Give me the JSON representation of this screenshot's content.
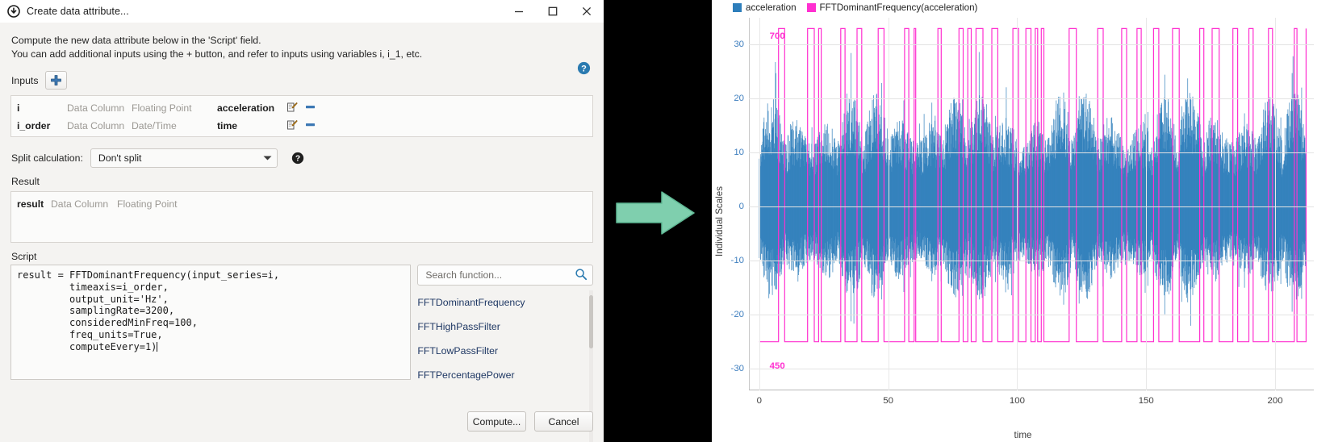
{
  "dialog": {
    "title": "Create data attribute...",
    "title_icon": "circle-arrow-down-icon",
    "window": {
      "minimize": "minimize-icon",
      "maximize": "maximize-icon",
      "close": "close-icon"
    },
    "intro_line1": "Compute the new data attribute below in the 'Script' field.",
    "intro_line2": "You can add additional inputs using the + button, and refer to inputs using variables i, i_1, etc.",
    "help_icon": "help-icon",
    "inputs": {
      "label": "Inputs",
      "add_button": "plus-icon",
      "rows": [
        {
          "var": "i",
          "kind": "Data Column",
          "type": "Floating Point",
          "value": "acceleration",
          "edit_icon": "edit-pencil-icon",
          "remove_icon": "remove-minus-icon"
        },
        {
          "var": "i_order",
          "kind": "Data Column",
          "type": "Date/Time",
          "value": "time",
          "edit_icon": "edit-pencil-icon",
          "remove_icon": "remove-minus-icon"
        }
      ]
    },
    "split": {
      "label": "Split calculation:",
      "value": "Don't split",
      "options": [
        "Don't split"
      ],
      "help_icon": "help-icon"
    },
    "result": {
      "label": "Result",
      "var": "result",
      "kind": "Data Column",
      "type": "Floating Point"
    },
    "script": {
      "label": "Script",
      "lines": [
        "result = FFTDominantFrequency(input_series=i,",
        "         timeaxis=i_order,",
        "         output_unit='Hz',",
        "         samplingRate=3200,",
        "         consideredMinFreq=100,",
        "         freq_units=True,",
        "         computeEvery=1)"
      ]
    },
    "functions": {
      "search_placeholder": "Search function...",
      "search_value": "",
      "search_icon": "magnifier-icon",
      "items": [
        "FFTDominantFrequency",
        "FFTHighPassFilter",
        "FFTLowPassFilter",
        "FFTPercentagePower"
      ]
    },
    "buttons": {
      "compute": "Compute...",
      "cancel": "Cancel"
    }
  },
  "transition": {
    "arrow_icon": "right-arrow-icon",
    "arrow_color": "#7fcfae"
  },
  "chart_data": {
    "type": "line",
    "title": "",
    "xlabel": "time",
    "ylabel": "Individual Scales",
    "xlim": [
      -4,
      215
    ],
    "ylim": [
      -34,
      35
    ],
    "xticks": [
      0,
      50,
      100,
      150,
      200
    ],
    "yticks": [
      30,
      20,
      10,
      0,
      -10,
      -20,
      -30
    ],
    "grid": true,
    "legend_position": "top-left",
    "annotations": [
      {
        "text": "700",
        "x": 7,
        "y": 31.5,
        "color": "#ff2fd0"
      },
      {
        "text": "450",
        "x": 7,
        "y": -29.5,
        "color": "#ff2fd0"
      }
    ],
    "series": [
      {
        "name": "acceleration",
        "color": "#2e7ebb",
        "type": "dense-oscillation",
        "description": "High frequency vibration signal, envelope roughly -18 to +22, centred on 0",
        "envelope_min": -18,
        "envelope_max": 22,
        "mean": 0
      },
      {
        "name": "FFTDominantFrequency(acceleration)",
        "color": "#ff2fd0",
        "type": "step",
        "description": "Two-level square wave alternating between 450 Hz (low, drawn at -25) and 700 Hz (high, drawn at +33)",
        "low_value": 450,
        "high_value": 700,
        "low_plot_y": -25,
        "high_plot_y": 33
      }
    ]
  }
}
